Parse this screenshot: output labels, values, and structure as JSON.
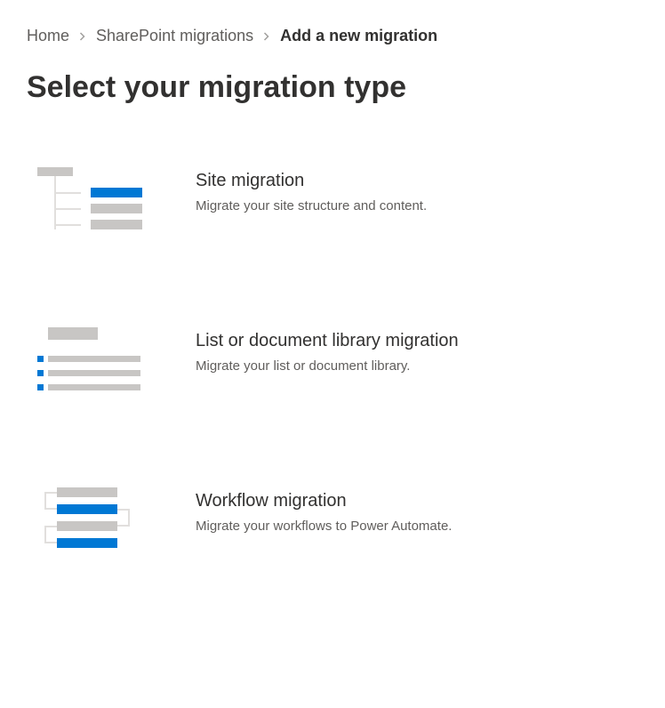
{
  "breadcrumb": {
    "home": "Home",
    "sharepoint": "SharePoint migrations",
    "current": "Add a new migration"
  },
  "page_title": "Select your migration type",
  "options": [
    {
      "title": "Site migration",
      "desc": "Migrate your site structure and content."
    },
    {
      "title": "List or document library migration",
      "desc": "Migrate your list or document library."
    },
    {
      "title": "Workflow migration",
      "desc": "Migrate your workflows to Power Automate."
    }
  ]
}
